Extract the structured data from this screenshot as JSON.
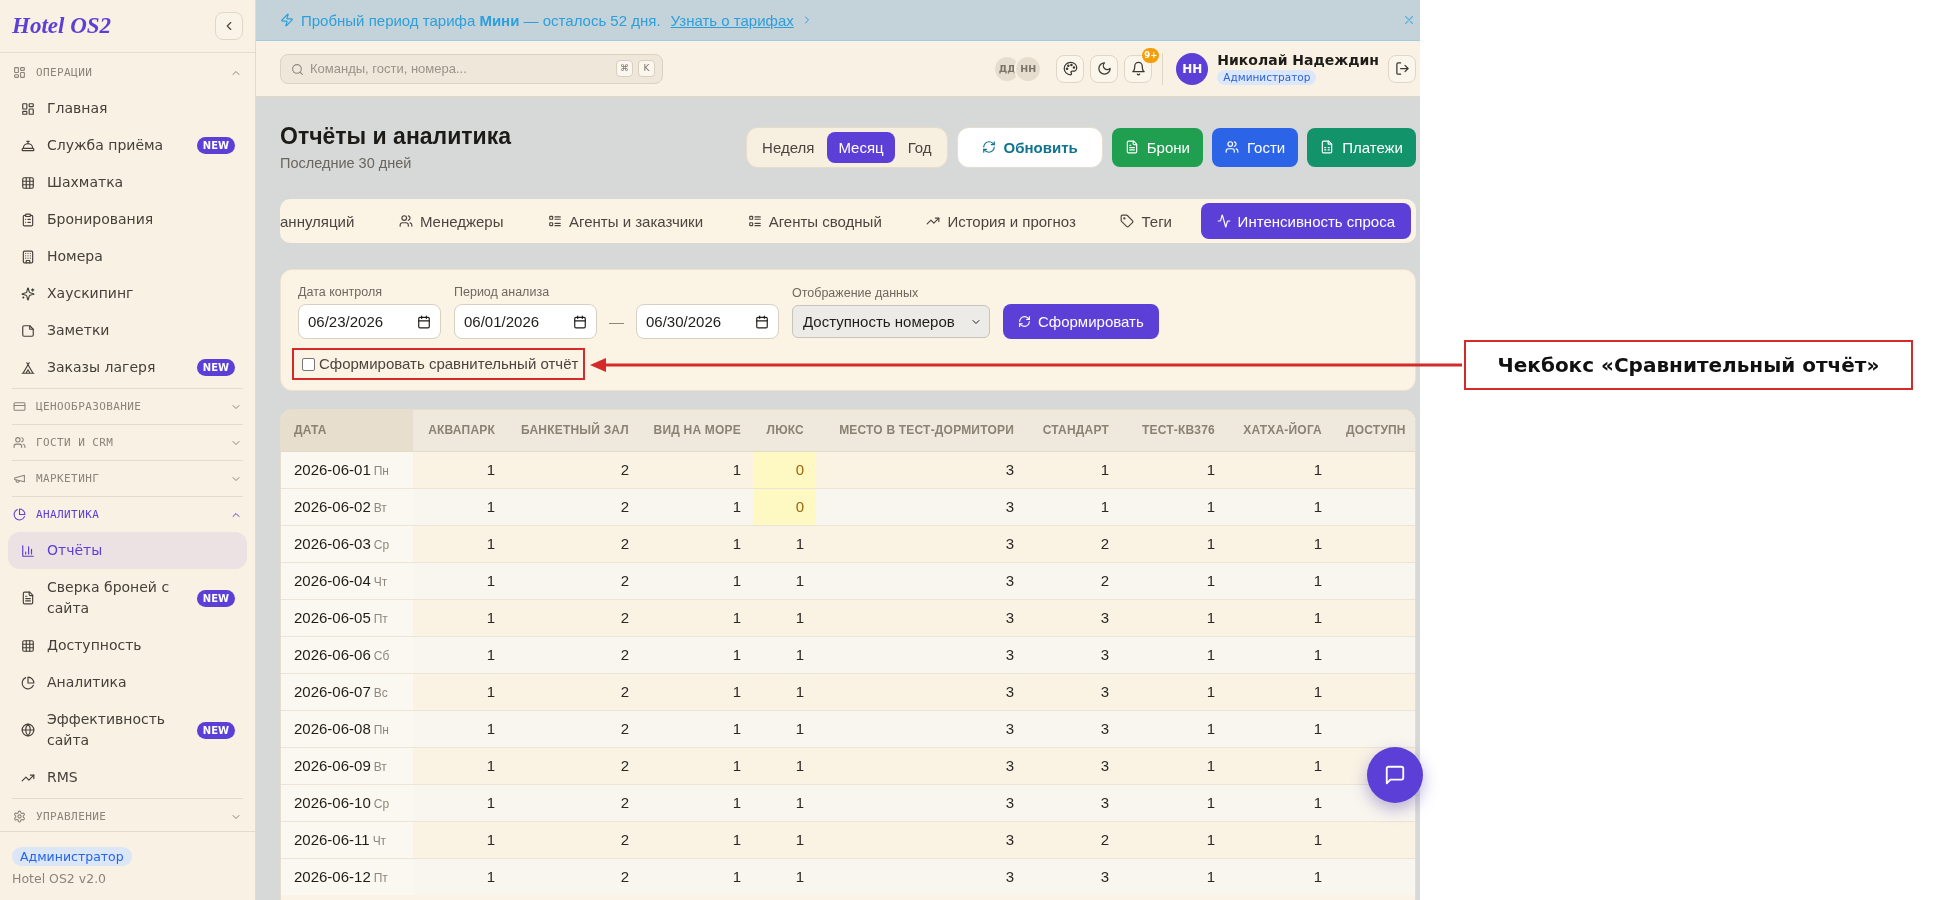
{
  "sidebar": {
    "logo": "Hotel OS2",
    "sections": [
      {
        "title": "ОПЕРАЦИИ",
        "expanded": true,
        "active": false,
        "items": [
          {
            "label": "Главная",
            "selected": false
          },
          {
            "label": "Служба приёма",
            "badge": "NEW",
            "selected": false
          },
          {
            "label": "Шахматка",
            "selected": false
          },
          {
            "label": "Бронирования",
            "selected": false
          },
          {
            "label": "Номера",
            "selected": false
          },
          {
            "label": "Хаускипинг",
            "selected": false
          },
          {
            "label": "Заметки",
            "selected": false
          },
          {
            "label": "Заказы лагеря",
            "badge": "NEW",
            "selected": false
          }
        ]
      },
      {
        "title": "ЦЕНООБРАЗОВАНИЕ",
        "expanded": false,
        "active": false
      },
      {
        "title": "ГОСТИ И CRM",
        "expanded": false,
        "active": false
      },
      {
        "title": "МАРКЕТИНГ",
        "expanded": false,
        "active": false
      },
      {
        "title": "АНАЛИТИКА",
        "expanded": true,
        "active": true,
        "items": [
          {
            "label": "Отчёты",
            "selected": true
          },
          {
            "label": "Сверка броней с сайта",
            "badge": "NEW",
            "selected": false
          },
          {
            "label": "Доступность",
            "selected": false
          },
          {
            "label": "Аналитика",
            "selected": false
          },
          {
            "label": "Эффективность сайта",
            "badge": "NEW",
            "selected": false
          },
          {
            "label": "RMS",
            "selected": false
          }
        ]
      },
      {
        "title": "УПРАВЛЕНИЕ",
        "expanded": false,
        "active": false
      }
    ],
    "footer": {
      "role": "Администратор",
      "version": "Hotel OS2 v2.0"
    }
  },
  "banner": {
    "text": "Пробный период тарифа **Мини** — осталось 52 дня.",
    "link": "Узнать о тарифах"
  },
  "top_bar": {
    "search": {
      "placeholder": "Команды, гости, номера...",
      "shortcut": [
        "⌘",
        "K"
      ]
    },
    "online_users": [
      "ДД",
      "НН"
    ],
    "notifications": "9+",
    "user": {
      "initials": "НН",
      "name": "Николай Надеждин",
      "role": "Администратор"
    }
  },
  "page": {
    "title": "Отчёты и аналитика",
    "subtitle": "Последние 30 дней",
    "periods": [
      {
        "label": "Неделя",
        "selected": false
      },
      {
        "label": "Месяц",
        "selected": true
      },
      {
        "label": "Год",
        "selected": false
      }
    ],
    "actions": [
      {
        "label": "Обновить",
        "kind": "refresh"
      },
      {
        "label": "Брони",
        "kind": "bookings"
      },
      {
        "label": "Гости",
        "kind": "guests"
      },
      {
        "label": "Платежи",
        "kind": "payments"
      }
    ]
  },
  "report_tabs": [
    {
      "label": "аннуляций",
      "selected": false
    },
    {
      "label": "Менеджеры",
      "selected": false
    },
    {
      "label": "Агенты и заказчики",
      "selected": false
    },
    {
      "label": "Агенты сводный",
      "selected": false
    },
    {
      "label": "История и прогноз",
      "selected": false
    },
    {
      "label": "Теги",
      "selected": false
    },
    {
      "label": "Интенсивность спроса",
      "selected": true
    }
  ],
  "filters": {
    "control_date": {
      "label": "Дата контроля",
      "value": "06/23/2026"
    },
    "analysis_period": {
      "label": "Период анализа",
      "from": "06/01/2026",
      "separator": "—",
      "to": "06/30/2026"
    },
    "display": {
      "label": "Отображение данных",
      "value": "Доступность номеров"
    },
    "submit": "Сформировать",
    "compare": {
      "label": "Сформировать сравнительный отчёт",
      "checked": false,
      "annotated": true
    }
  },
  "table": {
    "columns": [
      "ДАТА",
      "АКВАПАРК",
      "БАНКЕТНЫЙ ЗАЛ",
      "ВИД НА МОРЕ",
      "ЛЮКС",
      "МЕСТО В ТЕСТ-ДОРМИТОРИ",
      "СТАНДАРТ",
      "ТЕСТ-КВ376",
      "ХАТХА-ЙОГА",
      "ДОСТУПН"
    ],
    "rows": [
      {
        "cells": [
          {
            "text": "2026-06-01",
            "weekday": "Пн",
            "highlighted": false
          },
          {
            "text": "1",
            "highlighted": false
          },
          {
            "text": "2",
            "highlighted": false
          },
          {
            "text": "1",
            "highlighted": false
          },
          {
            "text": "0",
            "highlighted": true
          },
          {
            "text": "3",
            "highlighted": false
          },
          {
            "text": "1",
            "highlighted": false
          },
          {
            "text": "1",
            "highlighted": false
          },
          {
            "text": "1",
            "highlighted": false
          }
        ]
      },
      {
        "cells": [
          {
            "text": "2026-06-02",
            "weekday": "Вт",
            "highlighted": false
          },
          {
            "text": "1",
            "highlighted": false
          },
          {
            "text": "2",
            "highlighted": false
          },
          {
            "text": "1",
            "highlighted": false
          },
          {
            "text": "0",
            "highlighted": true
          },
          {
            "text": "3",
            "highlighted": false
          },
          {
            "text": "1",
            "highlighted": false
          },
          {
            "text": "1",
            "highlighted": false
          },
          {
            "text": "1",
            "highlighted": false
          }
        ]
      },
      {
        "cells": [
          {
            "text": "2026-06-03",
            "weekday": "Ср",
            "highlighted": false
          },
          {
            "text": "1",
            "highlighted": false
          },
          {
            "text": "2",
            "highlighted": false
          },
          {
            "text": "1",
            "highlighted": false
          },
          {
            "text": "1",
            "highlighted": false
          },
          {
            "text": "3",
            "highlighted": false
          },
          {
            "text": "2",
            "highlighted": false
          },
          {
            "text": "1",
            "highlighted": false
          },
          {
            "text": "1",
            "highlighted": false
          }
        ]
      },
      {
        "cells": [
          {
            "text": "2026-06-04",
            "weekday": "Чт",
            "highlighted": false
          },
          {
            "text": "1",
            "highlighted": false
          },
          {
            "text": "2",
            "highlighted": false
          },
          {
            "text": "1",
            "highlighted": false
          },
          {
            "text": "1",
            "highlighted": false
          },
          {
            "text": "3",
            "highlighted": false
          },
          {
            "text": "2",
            "highlighted": false
          },
          {
            "text": "1",
            "highlighted": false
          },
          {
            "text": "1",
            "highlighted": false
          }
        ]
      },
      {
        "cells": [
          {
            "text": "2026-06-05",
            "weekday": "Пт",
            "highlighted": false
          },
          {
            "text": "1",
            "highlighted": false
          },
          {
            "text": "2",
            "highlighted": false
          },
          {
            "text": "1",
            "highlighted": false
          },
          {
            "text": "1",
            "highlighted": false
          },
          {
            "text": "3",
            "highlighted": false
          },
          {
            "text": "3",
            "highlighted": false
          },
          {
            "text": "1",
            "highlighted": false
          },
          {
            "text": "1",
            "highlighted": false
          }
        ]
      },
      {
        "cells": [
          {
            "text": "2026-06-06",
            "weekday": "Сб",
            "highlighted": false
          },
          {
            "text": "1",
            "highlighted": false
          },
          {
            "text": "2",
            "highlighted": false
          },
          {
            "text": "1",
            "highlighted": false
          },
          {
            "text": "1",
            "highlighted": false
          },
          {
            "text": "3",
            "highlighted": false
          },
          {
            "text": "3",
            "highlighted": false
          },
          {
            "text": "1",
            "highlighted": false
          },
          {
            "text": "1",
            "highlighted": false
          }
        ]
      },
      {
        "cells": [
          {
            "text": "2026-06-07",
            "weekday": "Вс",
            "highlighted": false
          },
          {
            "text": "1",
            "highlighted": false
          },
          {
            "text": "2",
            "highlighted": false
          },
          {
            "text": "1",
            "highlighted": false
          },
          {
            "text": "1",
            "highlighted": false
          },
          {
            "text": "3",
            "highlighted": false
          },
          {
            "text": "3",
            "highlighted": false
          },
          {
            "text": "1",
            "highlighted": false
          },
          {
            "text": "1",
            "highlighted": false
          }
        ]
      },
      {
        "cells": [
          {
            "text": "2026-06-08",
            "weekday": "Пн",
            "highlighted": false
          },
          {
            "text": "1",
            "highlighted": false
          },
          {
            "text": "2",
            "highlighted": false
          },
          {
            "text": "1",
            "highlighted": false
          },
          {
            "text": "1",
            "highlighted": false
          },
          {
            "text": "3",
            "highlighted": false
          },
          {
            "text": "3",
            "highlighted": false
          },
          {
            "text": "1",
            "highlighted": false
          },
          {
            "text": "1",
            "highlighted": false
          }
        ]
      },
      {
        "cells": [
          {
            "text": "2026-06-09",
            "weekday": "Вт",
            "highlighted": false
          },
          {
            "text": "1",
            "highlighted": false
          },
          {
            "text": "2",
            "highlighted": false
          },
          {
            "text": "1",
            "highlighted": false
          },
          {
            "text": "1",
            "highlighted": false
          },
          {
            "text": "3",
            "highlighted": false
          },
          {
            "text": "3",
            "highlighted": false
          },
          {
            "text": "1",
            "highlighted": false
          },
          {
            "text": "1",
            "highlighted": false
          }
        ]
      },
      {
        "cells": [
          {
            "text": "2026-06-10",
            "weekday": "Ср",
            "highlighted": false
          },
          {
            "text": "1",
            "highlighted": false
          },
          {
            "text": "2",
            "highlighted": false
          },
          {
            "text": "1",
            "highlighted": false
          },
          {
            "text": "1",
            "highlighted": false
          },
          {
            "text": "3",
            "highlighted": false
          },
          {
            "text": "3",
            "highlighted": false
          },
          {
            "text": "1",
            "highlighted": false
          },
          {
            "text": "1",
            "highlighted": false
          }
        ]
      },
      {
        "cells": [
          {
            "text": "2026-06-11",
            "weekday": "Чт",
            "highlighted": false
          },
          {
            "text": "1",
            "highlighted": false
          },
          {
            "text": "2",
            "highlighted": false
          },
          {
            "text": "1",
            "highlighted": false
          },
          {
            "text": "1",
            "highlighted": false
          },
          {
            "text": "3",
            "highlighted": false
          },
          {
            "text": "2",
            "highlighted": false
          },
          {
            "text": "1",
            "highlighted": false
          },
          {
            "text": "1",
            "highlighted": false
          }
        ]
      },
      {
        "cells": [
          {
            "text": "2026-06-12",
            "weekday": "Пт",
            "highlighted": false
          },
          {
            "text": "1",
            "highlighted": false
          },
          {
            "text": "2",
            "highlighted": false
          },
          {
            "text": "1",
            "highlighted": false
          },
          {
            "text": "1",
            "highlighted": false
          },
          {
            "text": "3",
            "highlighted": false
          },
          {
            "text": "3",
            "highlighted": false
          },
          {
            "text": "1",
            "highlighted": false
          },
          {
            "text": "1",
            "highlighted": false
          }
        ]
      }
    ]
  },
  "annotation": {
    "label": "Чекбокс «Сравнительный отчёт»"
  }
}
